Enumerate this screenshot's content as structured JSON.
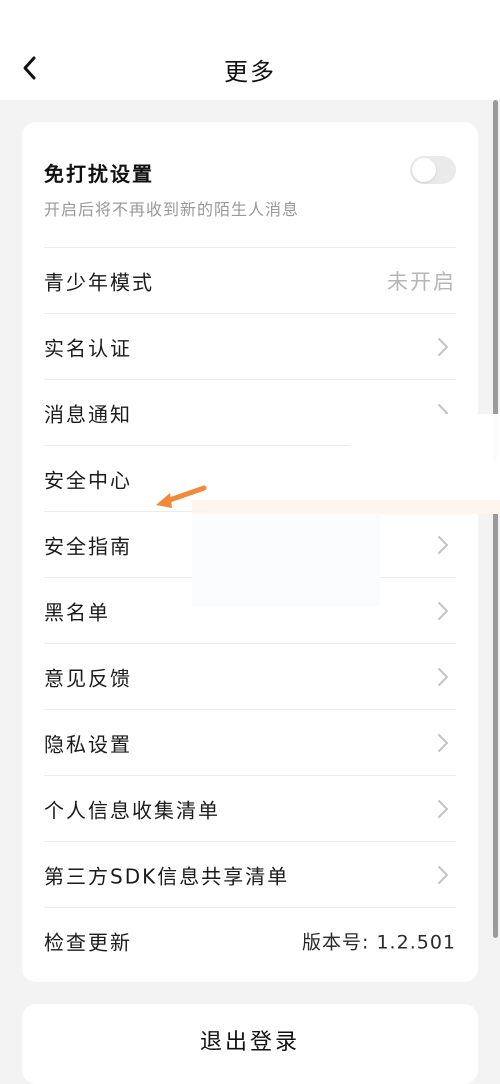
{
  "header": {
    "title": "更多",
    "back_icon": "chevron-left-icon"
  },
  "settings": {
    "do_not_disturb": {
      "title": "免打扰设置",
      "description": "开启后将不再收到新的陌生人消息",
      "enabled": false
    },
    "items": [
      {
        "label": "青少年模式",
        "value": "未开启"
      },
      {
        "label": "实名认证",
        "icon": "chevron-right-icon"
      },
      {
        "label": "消息通知",
        "icon": "chevron-right-icon"
      },
      {
        "label": "安全中心",
        "icon": "chevron-right-icon"
      },
      {
        "label": "安全指南",
        "icon": "chevron-right-icon"
      },
      {
        "label": "黑名单",
        "icon": "chevron-right-icon"
      },
      {
        "label": "意见反馈",
        "icon": "chevron-right-icon"
      },
      {
        "label": "隐私设置",
        "icon": "chevron-right-icon"
      },
      {
        "label": "个人信息收集清单",
        "icon": "chevron-right-icon"
      },
      {
        "label": "第三方SDK信息共享清单",
        "icon": "chevron-right-icon"
      },
      {
        "label": "检查更新",
        "value": "版本号: 1.2.501"
      }
    ]
  },
  "logout": {
    "label": "退出登录"
  },
  "colors": {
    "background": "#f3f3f3",
    "card": "#ffffff",
    "annotation_arrow": "#f08a3a",
    "muted_text": "#b6b6b6"
  }
}
